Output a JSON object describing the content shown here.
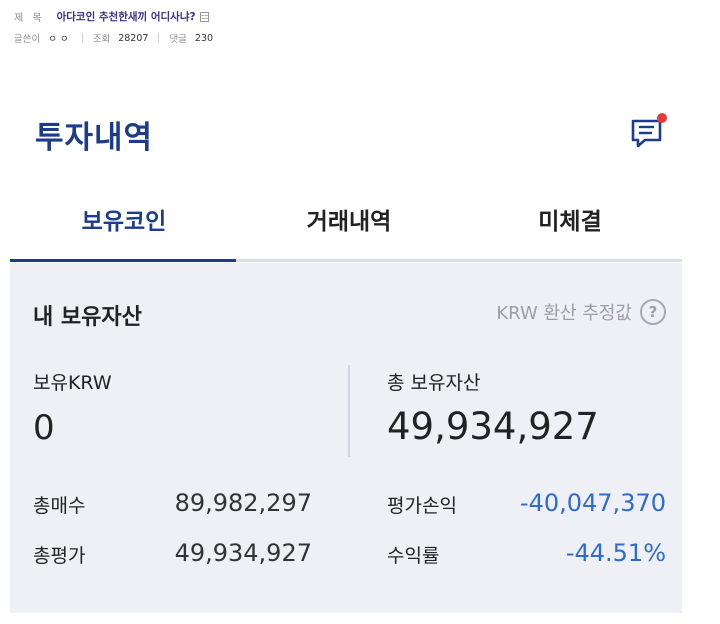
{
  "post": {
    "title_label": "제 목",
    "title": "아다코인 추천한새끼 어디사냐?",
    "author_label": "글쓴이",
    "author": "ㅇㅇ",
    "views_label": "조회",
    "views": "28207",
    "comments_label": "댓글",
    "comments": "230"
  },
  "app": {
    "title": "투자내역",
    "tabs": [
      {
        "label": "보유코인",
        "active": true
      },
      {
        "label": "거래내역",
        "active": false
      },
      {
        "label": "미체결",
        "active": false
      }
    ],
    "accent_color": "#1b3d8b",
    "notification_dot_color": "#e53b3b"
  },
  "holdings": {
    "title": "내 보유자산",
    "estimate_label": "KRW 환산 추정값",
    "help_symbol": "?",
    "krw_label": "보유KRW",
    "krw_value": "0",
    "total_label": "총 보유자산",
    "total_value": "49,934,927",
    "total_buy_label": "총매수",
    "total_buy_value": "89,982,297",
    "total_eval_label": "총평가",
    "total_eval_value": "49,934,927",
    "pnl_label": "평가손익",
    "pnl_value": "-40,047,370",
    "return_label": "수익률",
    "return_value": "-44.51%"
  }
}
